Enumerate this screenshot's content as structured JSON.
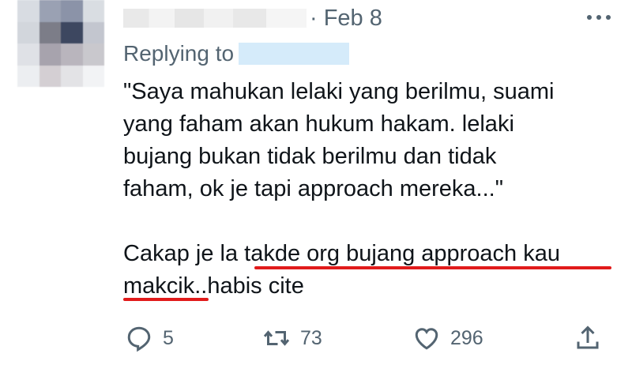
{
  "tweet": {
    "date_text": "· Feb 8",
    "replying_to_label": "Replying to",
    "body": "\"Saya mahukan lelaki yang berilmu, suami\nyang faham akan hukum hakam. lelaki\nbujang bukan tidak berilmu dan tidak\nfaham, ok je tapi approach mereka...\"\n\nCakap je la takde org bujang approach kau\nmakcik..habis cite"
  },
  "actions": {
    "reply_count": "5",
    "retweet_count": "73",
    "like_count": "296"
  },
  "colors": {
    "text": "#0f1419",
    "muted": "#536471",
    "annotation_red": "#e11b1b"
  },
  "icons": [
    "more-icon",
    "reply-icon",
    "retweet-icon",
    "like-icon",
    "share-icon"
  ]
}
